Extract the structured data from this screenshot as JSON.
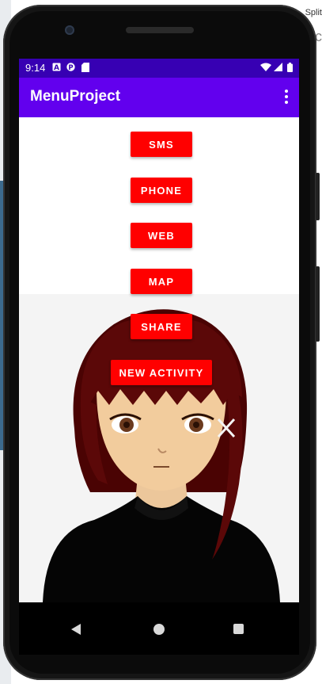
{
  "window": {
    "bg_text": "Split",
    "bg_text2": "c"
  },
  "status_bar": {
    "time": "9:14",
    "icons": [
      "a-icon",
      "p-icon",
      "sd-card-icon",
      "wifi-icon",
      "signal-icon",
      "battery-icon"
    ]
  },
  "app_bar": {
    "title": "MenuProject",
    "overflow_icon": "more-vert-icon"
  },
  "buttons": {
    "sms": "SMS",
    "phone": "PHONE",
    "web": "WEB",
    "map": "MAP",
    "share": "SHARE",
    "new_activity": "NEW ACTIVITY"
  },
  "image": {
    "description_name": "anime-girl-portrait"
  },
  "nav_bar": {
    "icons": [
      "back-icon",
      "home-icon",
      "recent-apps-icon"
    ]
  },
  "colors": {
    "status_bar": "#3700b3",
    "app_bar": "#6200ee",
    "button": "#ff0000"
  }
}
